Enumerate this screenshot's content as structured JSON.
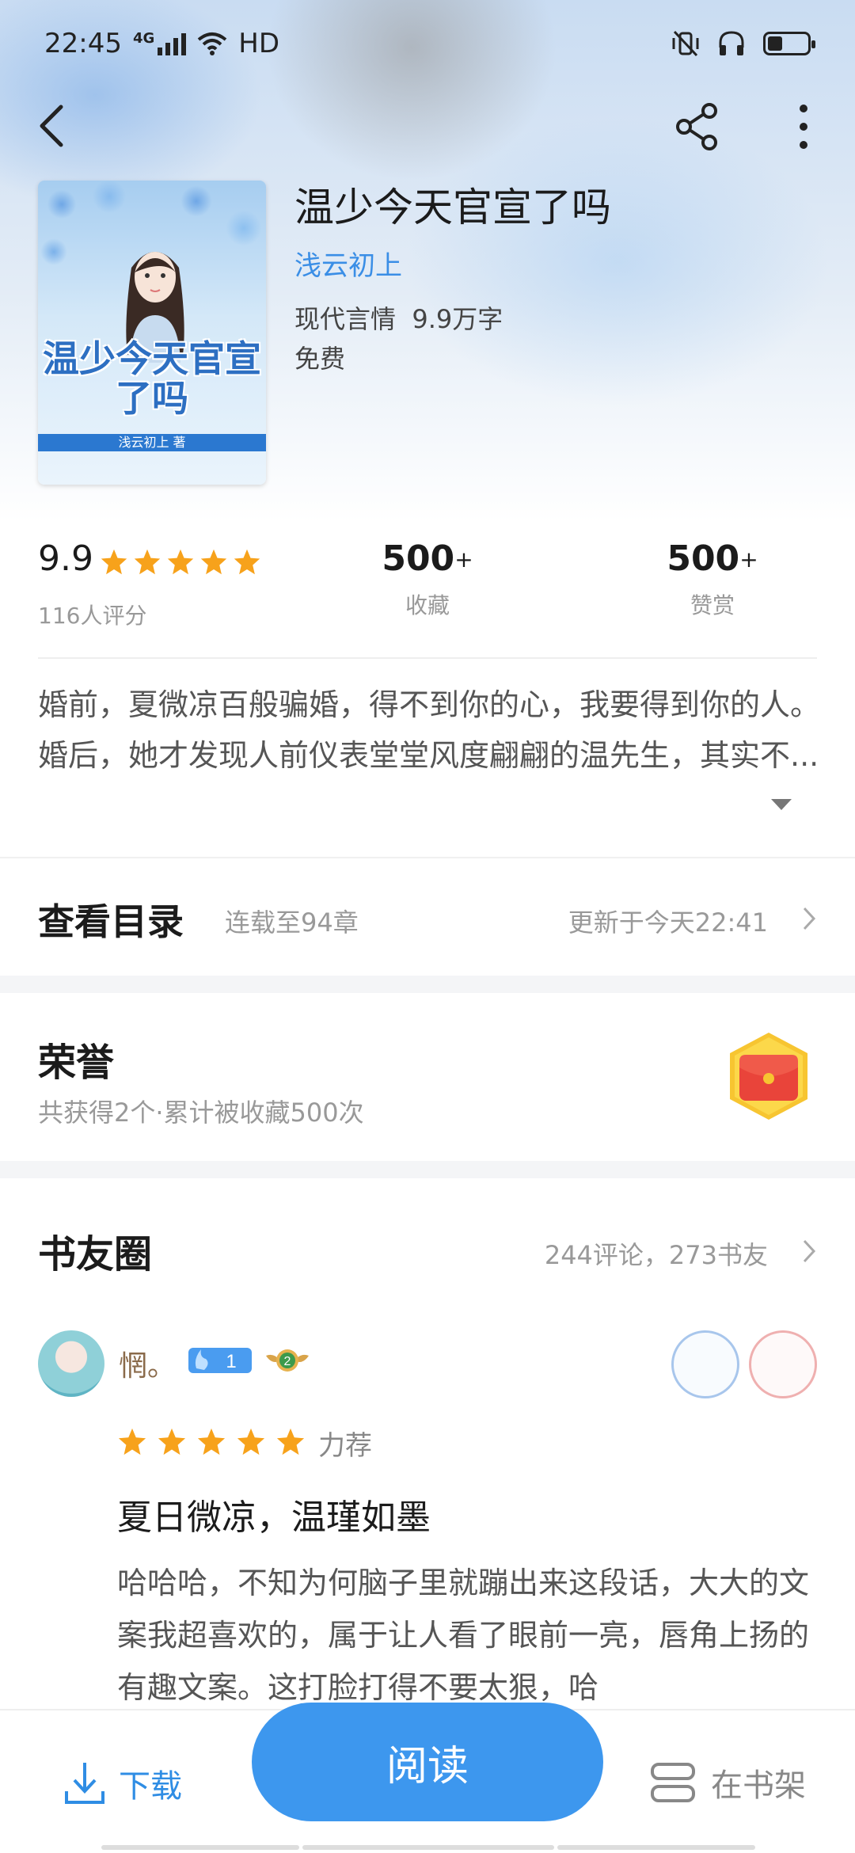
{
  "status_bar": {
    "time": "22:45",
    "network": "4G",
    "hd": "HD"
  },
  "book": {
    "title": "温少今天官宣了吗",
    "author": "浅云初上",
    "genre": "现代言情",
    "word_count": "9.9万字",
    "price": "免费",
    "cover_title": "温少今天官宣了吗",
    "cover_band": "浅云初上 著"
  },
  "stats": {
    "rating": "9.9",
    "rating_count": "116人评分",
    "stars": 5,
    "favorites_value": "500",
    "favorites_suffix": "+",
    "favorites_label": "收藏",
    "rewards_value": "500",
    "rewards_suffix": "+",
    "rewards_label": "赞赏"
  },
  "synopsis": "婚前，夏微凉百般骗婚，得不到你的心，我要得到你的人。婚后，她才发现人前仪表堂堂风度翩翩的温先生，其实不...",
  "toc": {
    "title": "查看目录",
    "chapters": "连载至94章",
    "updated": "更新于今天22:41"
  },
  "honor": {
    "title": "荣誉",
    "subtitle": "共获得2个·累计被收藏500次"
  },
  "circle": {
    "title": "书友圈",
    "stats": "244评论，273书友"
  },
  "review": {
    "username": "惘。",
    "level": "1",
    "rank": "2",
    "stars": 5,
    "recommend": "力荐",
    "title": "夏日微凉，温瑾如墨",
    "body": "哈哈哈，不知为何脑子里就蹦出来这段话，大大的文案我超喜欢的，属于让人看了眼前一亮，唇角上扬的有趣文案。这打脸打得不要太狠，哈"
  },
  "bottom": {
    "download": "下载",
    "read": "阅读",
    "shelf": "在书架"
  },
  "colors": {
    "accent": "#3d97ee",
    "star": "#f7a21b",
    "link": "#3a8ee6"
  }
}
